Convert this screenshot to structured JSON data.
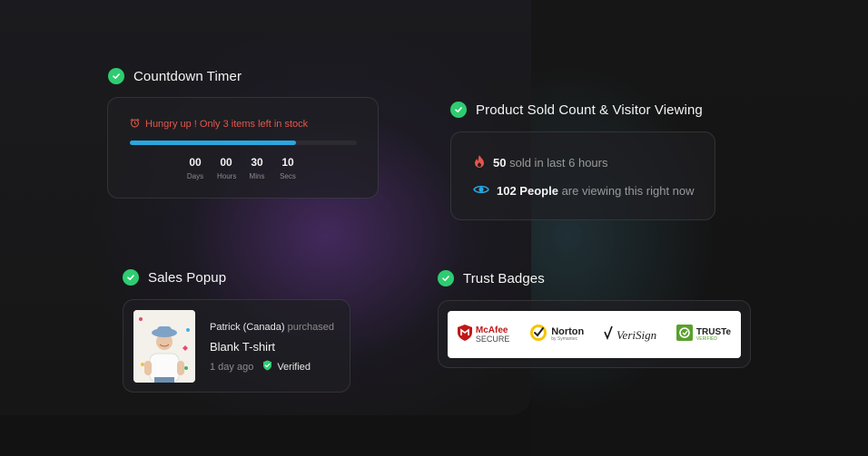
{
  "sections": {
    "countdown": {
      "title": "Countdown Timer"
    },
    "sold": {
      "title": "Product Sold Count & Visitor Viewing"
    },
    "sales": {
      "title": "Sales Popup"
    },
    "trust": {
      "title": "Trust Badges"
    }
  },
  "countdown": {
    "message": "Hungry up ! Only 3 items left in stock",
    "stock_progress": 0.73,
    "timer": [
      {
        "value": "00",
        "label": "Days"
      },
      {
        "value": "00",
        "label": "Hours"
      },
      {
        "value": "30",
        "label": "Mins"
      },
      {
        "value": "10",
        "label": "Secs"
      }
    ],
    "bar_color": "#2aa6e0",
    "message_color": "#e5564b"
  },
  "sold": {
    "sold_count": "50",
    "sold_text": "sold in last 6 hours",
    "viewers": "102 People",
    "viewers_text": "are viewing this right now"
  },
  "sales": {
    "buyer": "Patrick (Canada)",
    "action": "purchased",
    "product": "Blank T-shirt",
    "time": "1 day ago",
    "verified": "Verified"
  },
  "trust": {
    "badges": [
      {
        "icon": "mcafee-shield-icon",
        "line1": "McAfee",
        "line2": "SECURE"
      },
      {
        "icon": "norton-check-icon",
        "line1": "Norton",
        "line2": "by Symantec"
      },
      {
        "icon": "verisign-check-icon",
        "line1": "VeriSign",
        "line2": ""
      },
      {
        "icon": "truste-icon",
        "line1": "TRUSTe",
        "line2": "VERIFIED"
      }
    ]
  },
  "colors": {
    "accent_green": "#2ecc71",
    "fire": "#e5564b",
    "eye": "#2aa6e0"
  }
}
